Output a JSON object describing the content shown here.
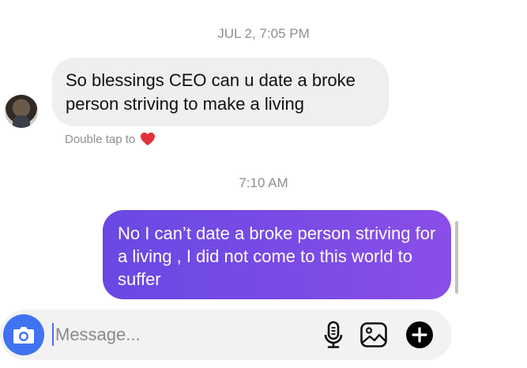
{
  "conversation": {
    "timestamp_1": "JUL 2, 7:05 PM",
    "incoming_message": "So blessings CEO can u date a broke person striving to make a living",
    "reaction_hint": "Double tap to",
    "timestamp_2": "7:10 AM",
    "outgoing_message": "No I can’t date a broke person striving for a living , I did not come to this world to suffer"
  },
  "composer": {
    "placeholder": "Message..."
  },
  "icons": {
    "camera": "camera-icon",
    "mic": "microphone-icon",
    "gallery": "gallery-icon",
    "add": "plus-icon",
    "heart": "heart-icon"
  },
  "colors": {
    "outgoing_bubble": "#7a4be6",
    "incoming_bubble": "#efefef",
    "camera_button": "#3f73f1",
    "heart": "#e0323c",
    "caret": "#4a6cf7"
  }
}
